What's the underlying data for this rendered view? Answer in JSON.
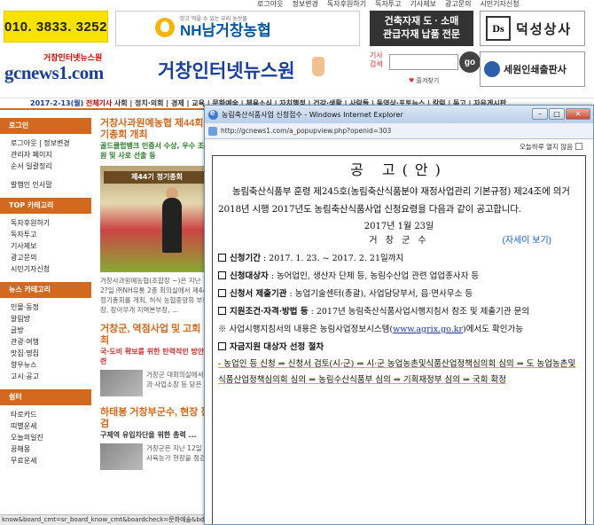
{
  "top_nav": [
    "로그아웃",
    "정보변경",
    "독자후원하기",
    "독자투고",
    "기사제보",
    "광고문의",
    "시민기자신청"
  ],
  "banners": {
    "phone": "010. 3833. 3252",
    "nh_tagline": "믿고 먹을 수 있는 우리 농산물",
    "nh_name": "NH남거창농협",
    "building_line1": "건축자재 도 · 소매",
    "building_line2": "관급자재 납품 전문",
    "ds_logo": "Ds",
    "ds_name": "덕성상사",
    "sewon_name": "세원인쇄출판사"
  },
  "logo": {
    "small": "거창인터넷뉴스원",
    "big": "gcnews1.com",
    "site_title": "거창인터넷뉴스원"
  },
  "search": {
    "label": "기사 검색",
    "placeholder": "",
    "go": "go",
    "bookmark": "즐겨찾기"
  },
  "date_bar": {
    "date": "2017-2-13(월)",
    "hot": "전체기사",
    "categories": "사회 | 정치·의회 | 경제 | 교육 | 문화예술 | 체육소식 | 자치행정 | 건강·생활 | 사람들 | 동영상·포토뉴스 | 칼럼 | 독고 | 자유게시판"
  },
  "sidebar": {
    "login_head": "로그인",
    "login_items": [
      "로그아웃 | 정보변경",
      "관리자 페이지",
      "순서 일괄정리",
      "",
      "발행인 인사말"
    ],
    "top_head": "TOP 카테고리",
    "top_items": [
      "독자후원하기",
      "독자투고",
      "기사제보",
      "광고문의",
      "시민기자신청"
    ],
    "news_head": "뉴스 카테고리",
    "news_items": [
      "인물·동정",
      "알림방",
      "글방",
      "관광·여행",
      "맛집·명집",
      "향우뉴스",
      "고시·공고"
    ],
    "forum_head": "쉼터",
    "forum_items": [
      "타로카드",
      "띠별운세",
      "오늘의일진",
      "꿈해몽",
      "무료운세"
    ]
  },
  "articles": [
    {
      "title": "거창사과원예농협 제44회 정기총회 개최",
      "sub": "골드클럽뱅크 인증서 수상, 우수 조합원 및 사로 선출 등",
      "photo_banner": "제44기 정기총회",
      "body": "거창사과원예농협(조합장 ~)은 지난 1월 2?일 ㈜NH유통 2층 회의실에서 제44기 정기총회를 개최, 허식 농협중앙회 부회장, 장아무개 지역본부장, ..."
    },
    {
      "title": "거창군, 역점사업 및 고회 개최",
      "sub": "국·도비 확보를 위한 탄력적인 방안 마련",
      "body": "거창군 대회의실에서 실·과·사업소장 등 당은 ..."
    },
    {
      "title": "하태봉 거창부군수, 현장 점검",
      "sub": "구제역 유입차단을 위한 총력 ...",
      "body": "거창군은 지난 12일 소 사육농가 현장을 점검 ..."
    }
  ],
  "status_bar": "know&board_cmt=sr_board_know_cmt&boardcheck=문화예술&bd",
  "popup": {
    "title": "농림축산식품사업 신청접수 - Windows Internet Explorer",
    "url": "http://gcnews1.com/a_popupview.php?openid=303",
    "today_label": "오늘하루 열지 않음",
    "notice_title": "공 고(안)",
    "lead": "농림축산식품부 훈령 제245호(농림축산식품분야 재정사업관리 기본규정) 제24조에 의거 2018년 시행 2017년도 농림축산식품사업 신청요령을 다음과 같이 공고합니다.",
    "date": "2017년 1월 23일",
    "org": "거 창 군 수",
    "detail_link": "(자세이 보기)",
    "items": [
      {
        "key": "신청기간",
        "value": " : 2017. 1. 23. ~ 2017. 2. 21일까지"
      },
      {
        "key": "신청대상자",
        "value": " : 농어업인, 생산자 단체 등, 농림수산업 관련 업업종사자 등"
      },
      {
        "key": "신청서 제출기관",
        "value": " : 농업기술센터(총괄), 사업담당부서, 읍·면사무소 등"
      },
      {
        "key": "지원조건·자격·방법 등",
        "value": " : 2017년 농림축산식품사업시행지침서 참조 및 제출기관 문의"
      }
    ],
    "note_prefix": "※ 사업시행지침서의 내용은 농림사업정보시스템(",
    "note_link": "www.agrix.go.kr",
    "note_suffix": ")에서도 확인가능",
    "selection_key": "자금지원 대상자 선정 절차",
    "flow": "- 농업인 등 신청 ⇒ 신청서 검토(시·군) ⇒ 시·군 농업농촌및식품산업정책심의회 심의 ⇒ 도 농업농촌및식품산업정책심의회 심의 ⇒ 농림수산식품부 심의 ⇒ 기획재정부 심의 ⇒ 국회 확정"
  }
}
